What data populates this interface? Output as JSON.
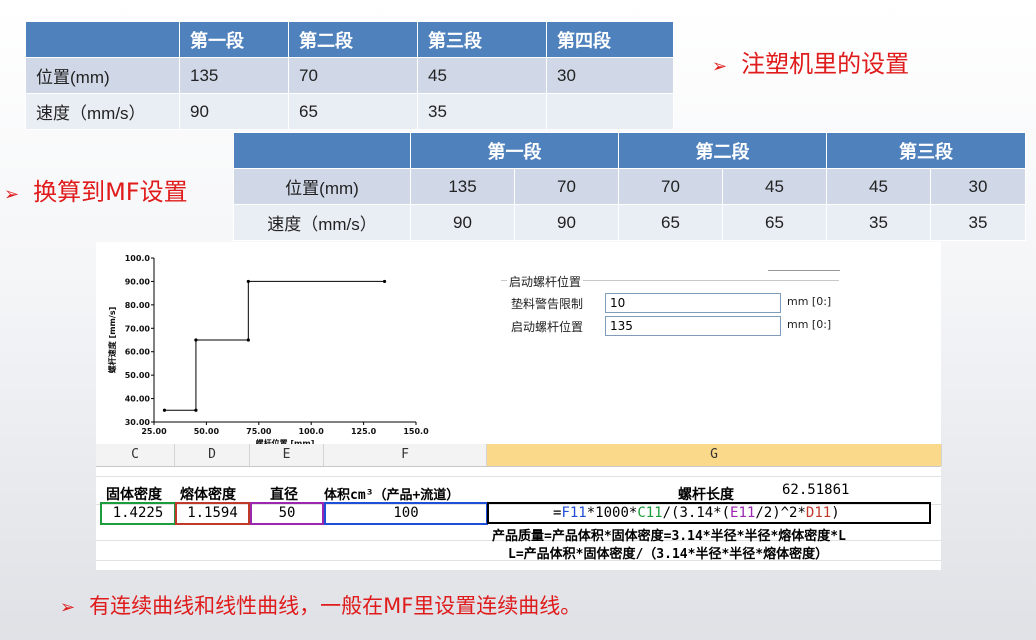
{
  "table1": {
    "headers": [
      "",
      "第一段",
      "第二段",
      "第三段",
      "第四段"
    ],
    "rows": [
      [
        "位置(mm)",
        "135",
        "70",
        "45",
        "30"
      ],
      [
        "速度（mm/s）",
        "90",
        "65",
        "35",
        ""
      ]
    ]
  },
  "bullet1": "注塑机里的设置",
  "bullet2": "换算到MF设置",
  "table2": {
    "headers": [
      "",
      "第一段",
      "第二段",
      "第三段"
    ],
    "rows": [
      [
        "位置(mm)",
        "135",
        "70",
        "70",
        "45",
        "45",
        "30"
      ],
      [
        "速度（mm/s）",
        "90",
        "90",
        "65",
        "65",
        "35",
        "35"
      ]
    ]
  },
  "chart_data": {
    "type": "line",
    "xlabel": "螺杆位置 [mm]",
    "ylabel": "螺杆速度 [mm/s]",
    "xlim": [
      25,
      150
    ],
    "ylim": [
      30,
      100
    ],
    "xticks": [
      "25.00",
      "50.00",
      "75.00",
      "100.0",
      "125.0",
      "150.0"
    ],
    "yticks": [
      "30.00",
      "40.00",
      "50.00",
      "60.00",
      "70.00",
      "80.00",
      "90.00",
      "100.0"
    ],
    "x": [
      30,
      45,
      45,
      70,
      70,
      135
    ],
    "y": [
      35,
      35,
      65,
      65,
      90,
      90
    ]
  },
  "settings": {
    "group_title": "启动螺杆位置",
    "rows": [
      {
        "label": "垫料警告限制",
        "value": "10",
        "unit": "mm [0:]"
      },
      {
        "label": "启动螺杆位置",
        "value": "135",
        "unit": "mm [0:]"
      }
    ]
  },
  "sheet": {
    "columns": [
      "C",
      "D",
      "E",
      "F",
      "G"
    ],
    "headers": [
      "固体密度",
      "熔体密度",
      "直径",
      "体积cm³（产品+流道）",
      "螺杆长度"
    ],
    "values": [
      "1.4225",
      "1.1594",
      "50",
      "100"
    ],
    "result": "62.51861",
    "formula": "=F11*1000*C11/(3.14*(E11/2)^2*D11)",
    "note1": "产品质量=产品体积*固体密度=3.14*半径*半径*熔体密度*L",
    "note2": "L=产品体积*固体密度/（3.14*半径*半径*熔体密度）"
  },
  "bullet3": "有连续曲线和线性曲线，一般在MF里设置连续曲线。",
  "colors": {
    "header": "#4f81bd",
    "row1": "#d0d8e8",
    "row2": "#e9edf4",
    "accent": "#e01b1b"
  }
}
